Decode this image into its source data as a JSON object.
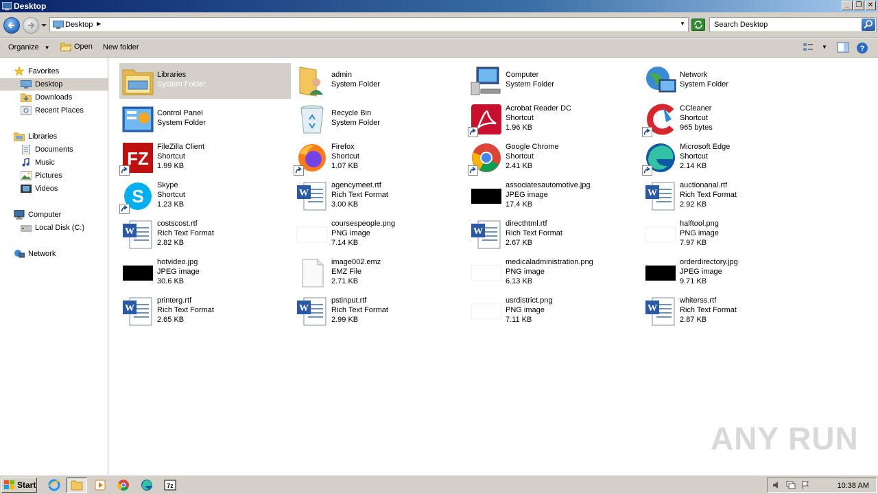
{
  "window": {
    "title": "Desktop"
  },
  "address": {
    "location": "Desktop",
    "search_placeholder": "Search Desktop"
  },
  "toolbar": {
    "organize": "Organize",
    "open": "Open",
    "new_folder": "New folder"
  },
  "nav": {
    "favorites": "Favorites",
    "desktop": "Desktop",
    "downloads": "Downloads",
    "recent_places": "Recent Places",
    "libraries": "Libraries",
    "documents": "Documents",
    "music": "Music",
    "pictures": "Pictures",
    "videos": "Videos",
    "computer": "Computer",
    "local_disk": "Local Disk (C:)",
    "network": "Network"
  },
  "items": [
    {
      "name": "Libraries",
      "type": "System Folder",
      "size": "",
      "icon": "libraries-icon"
    },
    {
      "name": "admin",
      "type": "System Folder",
      "size": "",
      "icon": "user-folder-icon"
    },
    {
      "name": "Computer",
      "type": "System Folder",
      "size": "",
      "icon": "computer-icon"
    },
    {
      "name": "Network",
      "type": "System Folder",
      "size": "",
      "icon": "network-icon"
    },
    {
      "name": "Control Panel",
      "type": "System Folder",
      "size": "",
      "icon": "control-panel-icon"
    },
    {
      "name": "Recycle Bin",
      "type": "System Folder",
      "size": "",
      "icon": "recycle-bin-icon"
    },
    {
      "name": "Acrobat Reader DC",
      "type": "Shortcut",
      "size": "1.96 KB",
      "icon": "acrobat-icon"
    },
    {
      "name": "CCleaner",
      "type": "Shortcut",
      "size": "965 bytes",
      "icon": "ccleaner-icon"
    },
    {
      "name": "FileZilla Client",
      "type": "Shortcut",
      "size": "1.99 KB",
      "icon": "filezilla-icon"
    },
    {
      "name": "Firefox",
      "type": "Shortcut",
      "size": "1.07 KB",
      "icon": "firefox-icon"
    },
    {
      "name": "Google Chrome",
      "type": "Shortcut",
      "size": "2.41 KB",
      "icon": "chrome-icon"
    },
    {
      "name": "Microsoft Edge",
      "type": "Shortcut",
      "size": "2.14 KB",
      "icon": "edge-icon"
    },
    {
      "name": "Skype",
      "type": "Shortcut",
      "size": "1.23 KB",
      "icon": "skype-icon"
    },
    {
      "name": "agencymeet.rtf",
      "type": "Rich Text Format",
      "size": "3.00 KB",
      "icon": "word-doc-icon"
    },
    {
      "name": "associatesautomotive.jpg",
      "type": "JPEG image",
      "size": "17.4 KB",
      "icon": "jpeg-thumbnail-icon"
    },
    {
      "name": "auctionanal.rtf",
      "type": "Rich Text Format",
      "size": "2.92 KB",
      "icon": "word-doc-icon"
    },
    {
      "name": "costscost.rtf",
      "type": "Rich Text Format",
      "size": "2.82 KB",
      "icon": "word-doc-icon"
    },
    {
      "name": "coursespeople.png",
      "type": "PNG image",
      "size": "7.14 KB",
      "icon": "png-thumbnail-icon"
    },
    {
      "name": "directhtml.rtf",
      "type": "Rich Text Format",
      "size": "2.67 KB",
      "icon": "word-doc-icon"
    },
    {
      "name": "halftool.png",
      "type": "PNG image",
      "size": "7.97 KB",
      "icon": "png-thumbnail-icon"
    },
    {
      "name": "hotvideo.jpg",
      "type": "JPEG image",
      "size": "30.6 KB",
      "icon": "jpeg-thumbnail-icon"
    },
    {
      "name": "image002.emz",
      "type": "EMZ File",
      "size": "2.71 KB",
      "icon": "blank-file-icon"
    },
    {
      "name": "medicaladministration.png",
      "type": "PNG image",
      "size": "6.13 KB",
      "icon": "png-thumbnail-icon"
    },
    {
      "name": "orderdirectory.jpg",
      "type": "JPEG image",
      "size": "9.71 KB",
      "icon": "jpeg-thumbnail-icon"
    },
    {
      "name": "printerg.rtf",
      "type": "Rich Text Format",
      "size": "2.65 KB",
      "icon": "word-doc-icon"
    },
    {
      "name": "pstinput.rtf",
      "type": "Rich Text Format",
      "size": "2.99 KB",
      "icon": "word-doc-icon"
    },
    {
      "name": "usrdistrict.png",
      "type": "PNG image",
      "size": "7.11 KB",
      "icon": "png-thumbnail-icon"
    },
    {
      "name": "whiterss.rtf",
      "type": "Rich Text Format",
      "size": "2.87 KB",
      "icon": "word-doc-icon"
    }
  ],
  "taskbar": {
    "start": "Start",
    "clock": "10:38 AM"
  },
  "watermark": "ANY RUN",
  "colors": {
    "titlebar": "#0a246a",
    "selection": "#d4d0c8",
    "chrome": "#d4d0c8"
  }
}
